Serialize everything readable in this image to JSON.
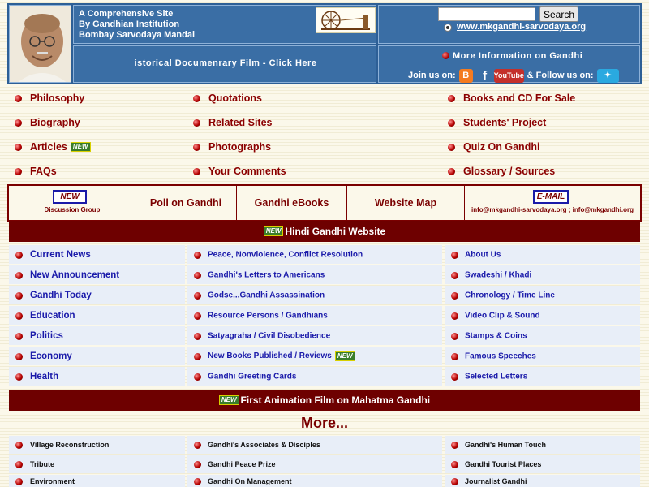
{
  "header": {
    "site_line1": "A Comprehensive Site",
    "site_line2": "By Gandhian Institution",
    "site_line3": "Bombay Sarvodaya Mandal",
    "film_link": "istorical Documenrary Film - Click Here",
    "search_placeholder": "",
    "search_button": "Search",
    "site_url": "www.mkgandhi-sarvodaya.org",
    "more_info": "More Information on Gandhi",
    "join_us": "Join us on:",
    "follow_us": "& Follow us on:",
    "youtube_label": "YouTube"
  },
  "menu": {
    "col1": [
      "Philosophy",
      "Biography",
      "Articles",
      "FAQs"
    ],
    "col2": [
      "Quotations",
      "Related Sites",
      "Photographs",
      "Your Comments"
    ],
    "col3": [
      "Books and CD For Sale",
      "Students' Project",
      "Quiz On Gandhi",
      "Glossary / Sources"
    ],
    "new_badge": "NEW"
  },
  "link_bar": {
    "new_box": "NEW",
    "discussion": "Discussion Group",
    "poll": "Poll on Gandhi",
    "ebooks": "Gandhi eBooks",
    "site_map": "Website Map",
    "email_box": "E-MAIL",
    "emails": "info@mkgandhi-sarvodaya.org ; info@mkgandhi.org"
  },
  "banner1": "Hindi Gandhi Website",
  "banner2": "First Animation Film on Mahatma Gandhi",
  "more_heading": "More...",
  "grid": [
    [
      "Current News",
      "Peace, Nonviolence, Conflict Resolution",
      "About Us"
    ],
    [
      "New Announcement",
      "Gandhi's Letters to Americans",
      "Swadeshi / Khadi"
    ],
    [
      "Gandhi Today",
      "Godse...Gandhi Assassination",
      "Chronology / Time Line"
    ],
    [
      "Education",
      "Resource Persons / Gandhians",
      "Video Clip & Sound"
    ],
    [
      "Politics",
      "Satyagraha / Civil Disobedience",
      "Stamps & Coins"
    ],
    [
      "Economy",
      "New Books Published / Reviews",
      "Famous Speeches"
    ],
    [
      "Health",
      "Gandhi Greeting Cards",
      "Selected Letters"
    ]
  ],
  "grid2": [
    [
      "Village Reconstruction",
      "Gandhi's Associates & Disciples",
      "Gandhi's Human Touch"
    ],
    [
      "Tribute",
      "Gandhi Peace Prize",
      "Gandhi Tourist Places"
    ],
    [
      "Environment",
      "Gandhi On Management",
      "Journalist Gandhi"
    ]
  ],
  "colors": {
    "header_blue": "#3a6ea5",
    "maroon": "#6e0000",
    "link_blue": "#1a1aaa"
  }
}
